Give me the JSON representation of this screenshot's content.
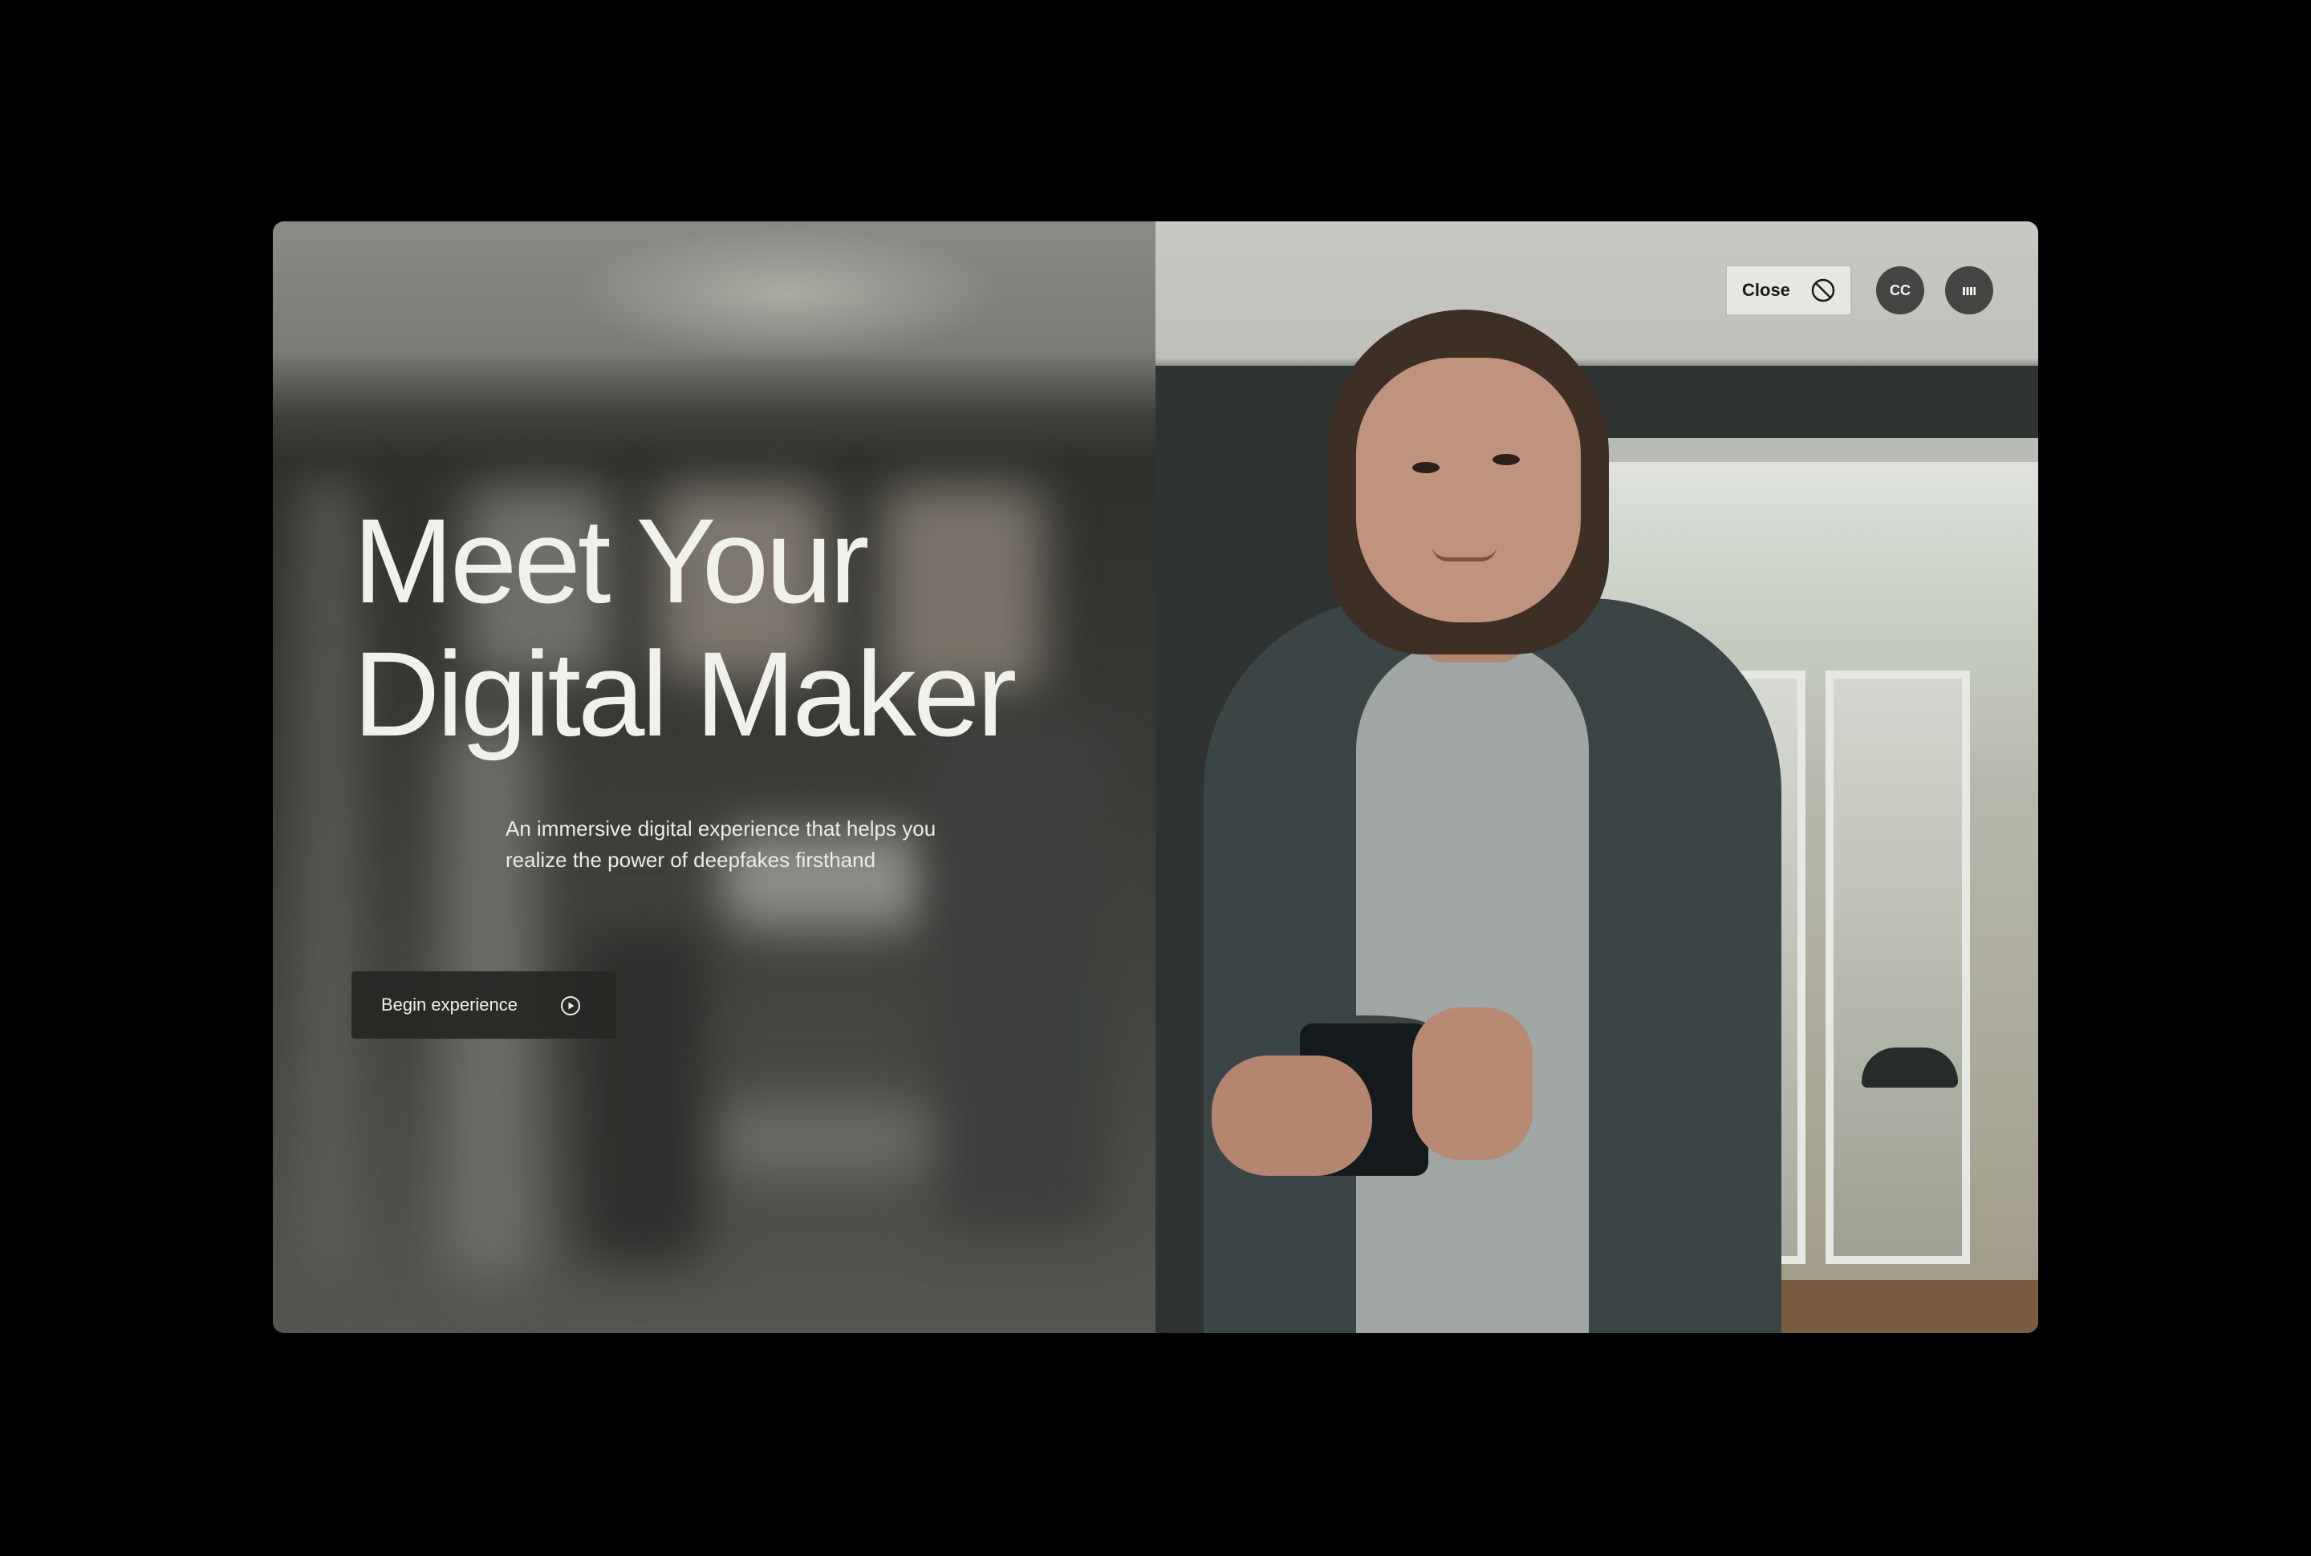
{
  "hero": {
    "title_line1": "Meet Your",
    "title_line2": "Digital Maker",
    "description": "An immersive digital experience that helps you realize the power of deepfakes firsthand",
    "cta_label": "Begin experience",
    "cta_icon": "play-circle-icon"
  },
  "controls": {
    "close_label": "Close",
    "close_icon": "prohibited-circle-icon",
    "captions_label": "CC",
    "audio_icon": "audio-bars-icon"
  },
  "colors": {
    "background": "#000000",
    "text": "#f1f1ec",
    "close_button_bg": "#e6e6e3",
    "round_button_bg": "#3a3a38"
  }
}
